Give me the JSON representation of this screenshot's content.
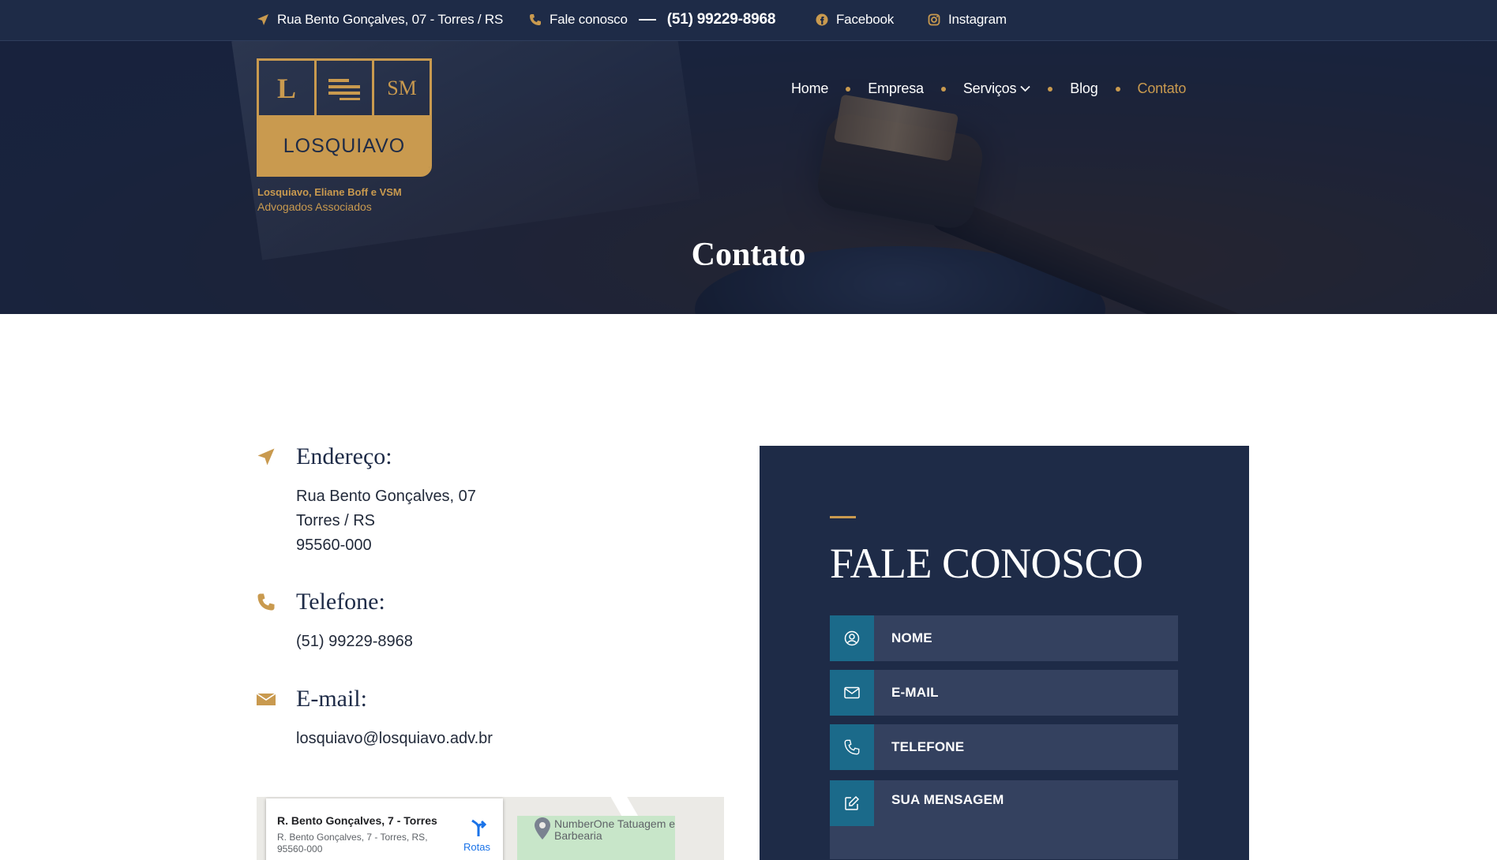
{
  "topbar": {
    "address": "Rua Bento Gonçalves, 07 - Torres / RS",
    "contact_label": "Fale conosco",
    "phone": "(51) 99229-8968",
    "facebook": "Facebook",
    "instagram": "Instagram"
  },
  "logo": {
    "letter_l": "L",
    "letter_ms": "SM",
    "name": "LOSQUIAVO",
    "subtitle_line1": "Losquiavo, Eliane Boff e VSM",
    "subtitle_line2": "Advogados Associados"
  },
  "nav": {
    "items": [
      {
        "label": "Home"
      },
      {
        "label": "Empresa"
      },
      {
        "label": "Serviços"
      },
      {
        "label": "Blog"
      },
      {
        "label": "Contato"
      }
    ],
    "active": "Contato"
  },
  "hero": {
    "title": "Contato"
  },
  "contact": {
    "address_label": "Endereço:",
    "address_lines": [
      "Rua Bento Gonçalves, 07",
      "Torres / RS",
      "95560-000"
    ],
    "phone_label": "Telefone:",
    "phone": "(51) 99229-8968",
    "email_label": "E-mail:",
    "email": "losquiavo@losquiavo.adv.br"
  },
  "map": {
    "place_title": "R. Bento Gonçalves, 7 - Torres",
    "place_address": "R. Bento Gonçalves, 7 - Torres, RS, 95560-000",
    "directions_label": "Rotas",
    "poi_label": "NumberOne Tatuagem e Barbearia"
  },
  "form": {
    "title": "FALE CONOSCO",
    "fields": {
      "name_placeholder": "NOME",
      "email_placeholder": "E-MAIL",
      "phone_placeholder": "TELEFONE",
      "message_placeholder": "SUA MENSAGEM"
    }
  },
  "colors": {
    "navy": "#1e2b47",
    "gold": "#c99a4f",
    "field_bg": "#34415f",
    "icon_bg": "#1b6a8a"
  }
}
